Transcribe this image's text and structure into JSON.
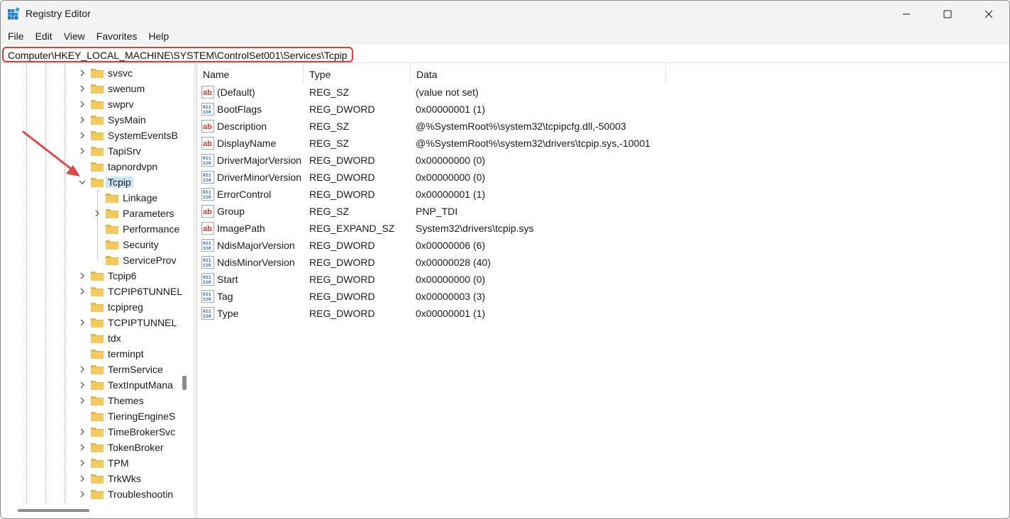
{
  "window": {
    "title": "Registry Editor",
    "minimize_icon": "minimize-icon",
    "maximize_icon": "maximize-icon",
    "close_icon": "close-icon"
  },
  "menu": [
    "File",
    "Edit",
    "View",
    "Favorites",
    "Help"
  ],
  "address": "Computer\\HKEY_LOCAL_MACHINE\\SYSTEM\\ControlSet001\\Services\\Tcpip",
  "colors": {
    "highlight_border": "#e23a3a",
    "selection": "#cce4f7",
    "folder": "#f4c95d",
    "arrow": "#e04848"
  },
  "tree": [
    {
      "label": "svsvc",
      "level": 0,
      "expander": "collapsed"
    },
    {
      "label": "swenum",
      "level": 0,
      "expander": "collapsed"
    },
    {
      "label": "swprv",
      "level": 0,
      "expander": "collapsed"
    },
    {
      "label": "SysMain",
      "level": 0,
      "expander": "collapsed"
    },
    {
      "label": "SystemEventsB",
      "level": 0,
      "expander": "collapsed"
    },
    {
      "label": "TapiSrv",
      "level": 0,
      "expander": "collapsed"
    },
    {
      "label": "tapnordvpn",
      "level": 0,
      "expander": "none"
    },
    {
      "label": "Tcpip",
      "level": 0,
      "expander": "expanded",
      "selected": true
    },
    {
      "label": "Linkage",
      "level": 1,
      "expander": "none"
    },
    {
      "label": "Parameters",
      "level": 1,
      "expander": "collapsed"
    },
    {
      "label": "Performance",
      "level": 1,
      "expander": "none"
    },
    {
      "label": "Security",
      "level": 1,
      "expander": "none"
    },
    {
      "label": "ServiceProv",
      "level": 1,
      "expander": "none"
    },
    {
      "label": "Tcpip6",
      "level": 0,
      "expander": "collapsed"
    },
    {
      "label": "TCPIP6TUNNEL",
      "level": 0,
      "expander": "collapsed"
    },
    {
      "label": "tcpipreg",
      "level": 0,
      "expander": "none"
    },
    {
      "label": "TCPIPTUNNEL",
      "level": 0,
      "expander": "collapsed"
    },
    {
      "label": "tdx",
      "level": 0,
      "expander": "none"
    },
    {
      "label": "terminpt",
      "level": 0,
      "expander": "none"
    },
    {
      "label": "TermService",
      "level": 0,
      "expander": "collapsed"
    },
    {
      "label": "TextInputMana",
      "level": 0,
      "expander": "collapsed"
    },
    {
      "label": "Themes",
      "level": 0,
      "expander": "collapsed"
    },
    {
      "label": "TieringEngineS",
      "level": 0,
      "expander": "none"
    },
    {
      "label": "TimeBrokerSvc",
      "level": 0,
      "expander": "collapsed"
    },
    {
      "label": "TokenBroker",
      "level": 0,
      "expander": "collapsed"
    },
    {
      "label": "TPM",
      "level": 0,
      "expander": "collapsed"
    },
    {
      "label": "TrkWks",
      "level": 0,
      "expander": "collapsed"
    },
    {
      "label": "Troubleshootin",
      "level": 0,
      "expander": "collapsed"
    }
  ],
  "columns": {
    "name": "Name",
    "type": "Type",
    "data": "Data"
  },
  "values": [
    {
      "name": "(Default)",
      "type": "REG_SZ",
      "data": "(value not set)",
      "icon": "string-value-icon"
    },
    {
      "name": "BootFlags",
      "type": "REG_DWORD",
      "data": "0x00000001 (1)",
      "icon": "binary-value-icon"
    },
    {
      "name": "Description",
      "type": "REG_SZ",
      "data": "@%SystemRoot%\\system32\\tcpipcfg.dll,-50003",
      "icon": "string-value-icon"
    },
    {
      "name": "DisplayName",
      "type": "REG_SZ",
      "data": "@%SystemRoot%\\system32\\drivers\\tcpip.sys,-10001",
      "icon": "string-value-icon"
    },
    {
      "name": "DriverMajorVersion",
      "type": "REG_DWORD",
      "data": "0x00000000 (0)",
      "icon": "binary-value-icon"
    },
    {
      "name": "DriverMinorVersion",
      "type": "REG_DWORD",
      "data": "0x00000000 (0)",
      "icon": "binary-value-icon"
    },
    {
      "name": "ErrorControl",
      "type": "REG_DWORD",
      "data": "0x00000001 (1)",
      "icon": "binary-value-icon"
    },
    {
      "name": "Group",
      "type": "REG_SZ",
      "data": "PNP_TDI",
      "icon": "string-value-icon"
    },
    {
      "name": "ImagePath",
      "type": "REG_EXPAND_SZ",
      "data": "System32\\drivers\\tcpip.sys",
      "icon": "string-value-icon"
    },
    {
      "name": "NdisMajorVersion",
      "type": "REG_DWORD",
      "data": "0x00000006 (6)",
      "icon": "binary-value-icon"
    },
    {
      "name": "NdisMinorVersion",
      "type": "REG_DWORD",
      "data": "0x00000028 (40)",
      "icon": "binary-value-icon"
    },
    {
      "name": "Start",
      "type": "REG_DWORD",
      "data": "0x00000000 (0)",
      "icon": "binary-value-icon"
    },
    {
      "name": "Tag",
      "type": "REG_DWORD",
      "data": "0x00000003 (3)",
      "icon": "binary-value-icon"
    },
    {
      "name": "Type",
      "type": "REG_DWORD",
      "data": "0x00000001 (1)",
      "icon": "binary-value-icon"
    }
  ]
}
